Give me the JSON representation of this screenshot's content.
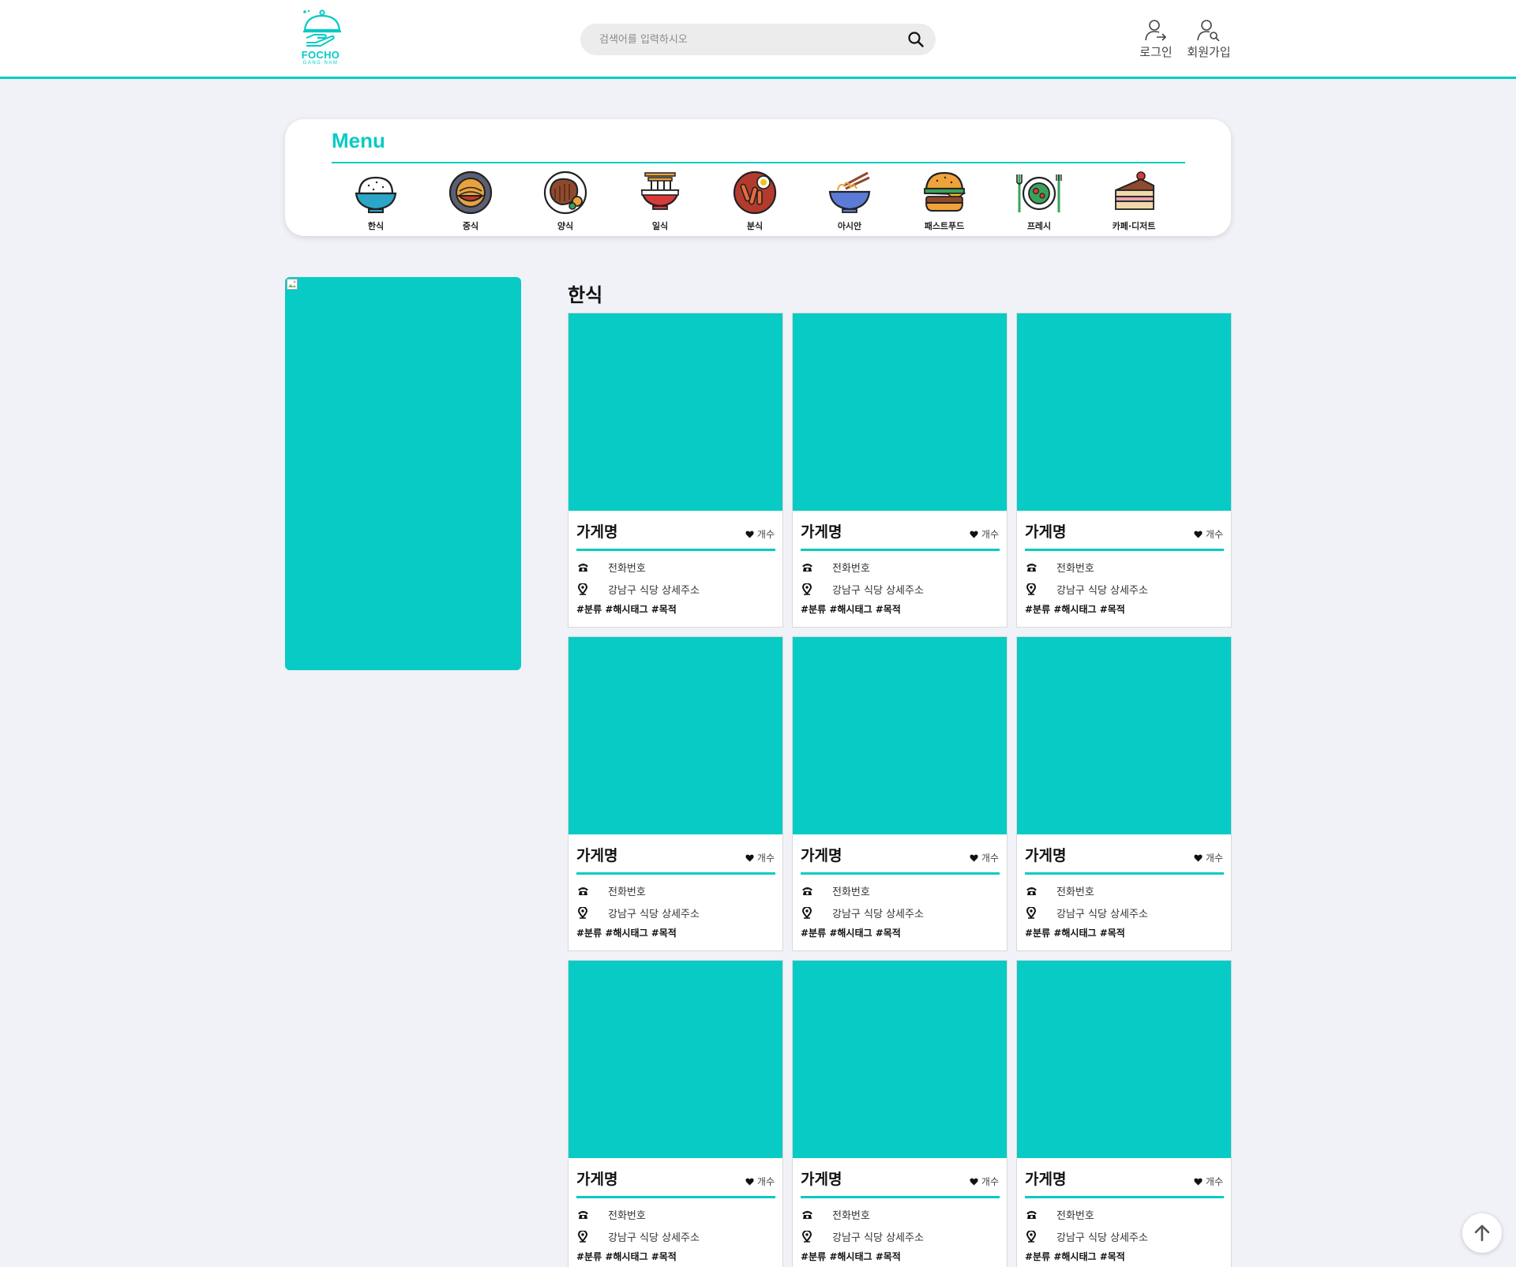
{
  "header": {
    "logo_title": "FOCHO",
    "logo_sub": "GANG NAM",
    "search_placeholder": "검색어를 입력하시오",
    "login_label": "로그인",
    "signup_label": "회원가입"
  },
  "menu": {
    "title": "Menu",
    "items": [
      {
        "label": "한식",
        "icon": "rice-bowl-icon"
      },
      {
        "label": "중식",
        "icon": "jjajang-bowl-icon"
      },
      {
        "label": "양식",
        "icon": "steak-plate-icon"
      },
      {
        "label": "일식",
        "icon": "tempura-udon-icon"
      },
      {
        "label": "분식",
        "icon": "tteokbokki-icon"
      },
      {
        "label": "아시안",
        "icon": "noodle-bowl-icon"
      },
      {
        "label": "패스트푸드",
        "icon": "burger-icon"
      },
      {
        "label": "프레시",
        "icon": "salad-plate-icon"
      },
      {
        "label": "카페·디저트",
        "icon": "cake-icon"
      }
    ]
  },
  "category_title": "한식",
  "cards": [
    {
      "name": "가게명",
      "likes": "개수",
      "phone": "전화번호",
      "address": "강남구 식당 상세주소",
      "tags": "#분류 #해시태그 #목적"
    },
    {
      "name": "가게명",
      "likes": "개수",
      "phone": "전화번호",
      "address": "강남구 식당 상세주소",
      "tags": "#분류 #해시태그 #목적"
    },
    {
      "name": "가게명",
      "likes": "개수",
      "phone": "전화번호",
      "address": "강남구 식당 상세주소",
      "tags": "#분류 #해시태그 #목적"
    },
    {
      "name": "가게명",
      "likes": "개수",
      "phone": "전화번호",
      "address": "강남구 식당 상세주소",
      "tags": "#분류 #해시태그 #목적"
    },
    {
      "name": "가게명",
      "likes": "개수",
      "phone": "전화번호",
      "address": "강남구 식당 상세주소",
      "tags": "#분류 #해시태그 #목적"
    },
    {
      "name": "가게명",
      "likes": "개수",
      "phone": "전화번호",
      "address": "강남구 식당 상세주소",
      "tags": "#분류 #해시태그 #목적"
    },
    {
      "name": "가게명",
      "likes": "개수",
      "phone": "전화번호",
      "address": "강남구 식당 상세주소",
      "tags": "#분류 #해시태그 #목적"
    },
    {
      "name": "가게명",
      "likes": "개수",
      "phone": "전화번호",
      "address": "강남구 식당 상세주소",
      "tags": "#분류 #해시태그 #목적"
    },
    {
      "name": "가게명",
      "likes": "개수",
      "phone": "전화번호",
      "address": "강남구 식당 상세주소",
      "tags": "#분류 #해시태그 #목적"
    }
  ],
  "colors": {
    "accent": "#07cbc4",
    "background": "#f1f2f7"
  }
}
